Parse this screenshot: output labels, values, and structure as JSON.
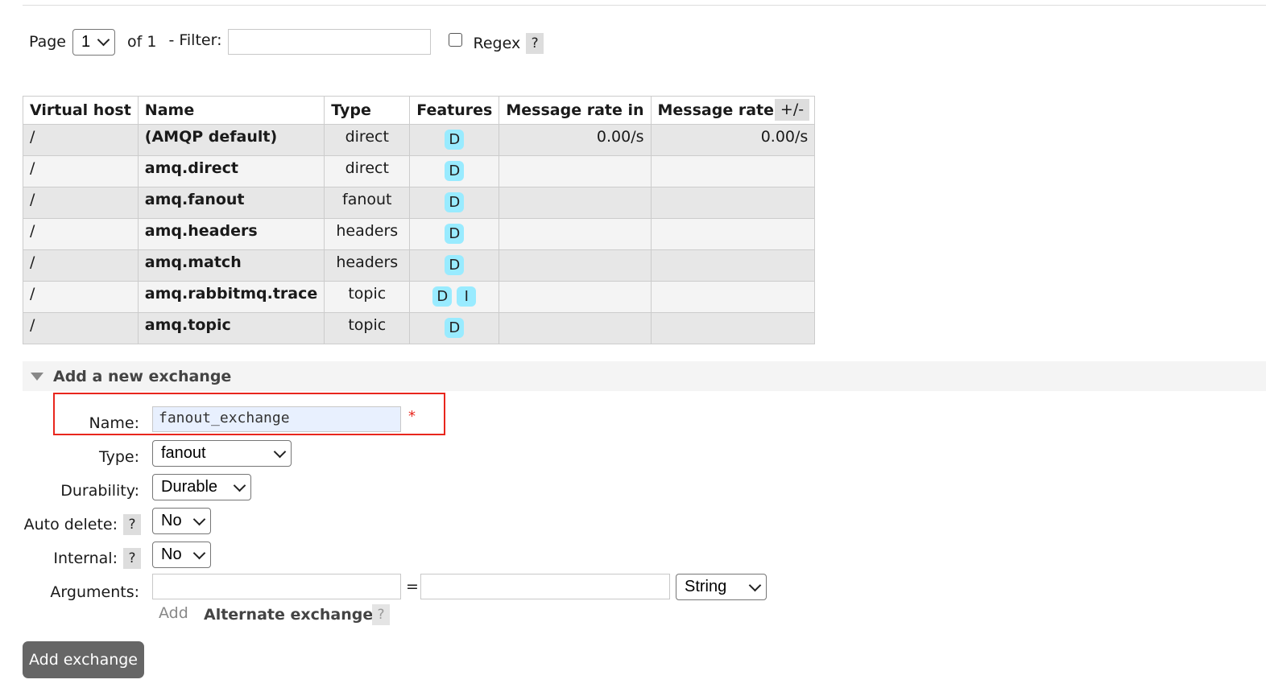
{
  "pager": {
    "page_label": "Page",
    "page_value": "1",
    "of_label": "of 1",
    "filter_label": "- Filter:",
    "filter_value": "",
    "regex_label": "Regex",
    "regex_checked": false,
    "help_label": "?"
  },
  "table": {
    "headers": [
      "Virtual host",
      "Name",
      "Type",
      "Features",
      "Message rate in",
      "Message rate out"
    ],
    "toggle_label": "+/-",
    "rows": [
      {
        "vhost": "/",
        "name": "(AMQP default)",
        "type": "direct",
        "features": [
          "D"
        ],
        "rate_in": "0.00/s",
        "rate_out": "0.00/s"
      },
      {
        "vhost": "/",
        "name": "amq.direct",
        "type": "direct",
        "features": [
          "D"
        ],
        "rate_in": "",
        "rate_out": ""
      },
      {
        "vhost": "/",
        "name": "amq.fanout",
        "type": "fanout",
        "features": [
          "D"
        ],
        "rate_in": "",
        "rate_out": ""
      },
      {
        "vhost": "/",
        "name": "amq.headers",
        "type": "headers",
        "features": [
          "D"
        ],
        "rate_in": "",
        "rate_out": ""
      },
      {
        "vhost": "/",
        "name": "amq.match",
        "type": "headers",
        "features": [
          "D"
        ],
        "rate_in": "",
        "rate_out": ""
      },
      {
        "vhost": "/",
        "name": "amq.rabbitmq.trace",
        "type": "topic",
        "features": [
          "D",
          "I"
        ],
        "rate_in": "",
        "rate_out": ""
      },
      {
        "vhost": "/",
        "name": "amq.topic",
        "type": "topic",
        "features": [
          "D"
        ],
        "rate_in": "",
        "rate_out": ""
      }
    ]
  },
  "add_exchange": {
    "section_title": "Add a new exchange",
    "name_label": "Name:",
    "name_value": "fanout_exchange",
    "required_mark": "*",
    "type_label": "Type:",
    "type_value": "fanout",
    "durability_label": "Durability:",
    "durability_value": "Durable",
    "auto_delete_label": "Auto delete:",
    "auto_delete_value": "No",
    "internal_label": "Internal:",
    "internal_value": "No",
    "arguments_label": "Arguments:",
    "arg_key": "",
    "arg_equals": "=",
    "arg_value": "",
    "arg_type": "String",
    "add_label": "Add",
    "alternate_exchange_label": "Alternate exchange",
    "help_label": "?",
    "submit_label": "Add exchange"
  },
  "colors": {
    "highlight_border": "#e8261d",
    "badge_bg": "#99ebff",
    "button_bg": "#666666",
    "autofill_bg": "#e8f0fe"
  }
}
